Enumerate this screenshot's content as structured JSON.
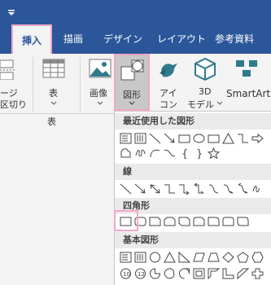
{
  "tabs": {
    "insert": "挿入",
    "draw": "描画",
    "design": "デザイン",
    "layout": "レイアウト",
    "references": "参考資料"
  },
  "ribbon": {
    "page_break_line1": "ージ",
    "page_break_line2": "区切り",
    "table": "表",
    "image": "画像",
    "shapes": "図形",
    "icons_line1": "アイ",
    "icons_line2": "コン",
    "model3d_line1": "3D",
    "model3d_line2": "モデル",
    "smartart": "SmartArt",
    "group_table": "表"
  },
  "dropdown": {
    "recent": "最近使用した図形",
    "lines": "線",
    "rectangles": "四角形",
    "basic": "基本図形"
  },
  "colors": {
    "titlebar": "#2b579a",
    "highlight": "#f4a6c8",
    "ribbon_bg": "#f3f3f3",
    "icon_teal": "#2f7a8c"
  }
}
